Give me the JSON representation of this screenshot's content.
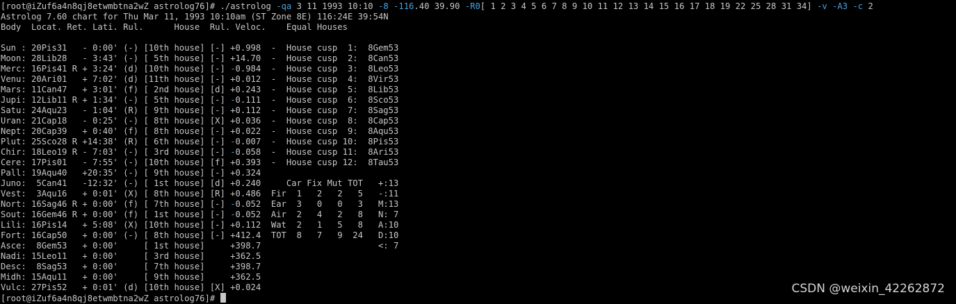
{
  "prompt": {
    "text": "[root@iZuf6a4n8qj8etwmbtna2wZ astrolog76]# ",
    "bottom": "[root@iZuf6a4n8qj8etwmbtna2wZ astrolog76]# "
  },
  "command": [
    {
      "t": "./astrolog ",
      "c": false
    },
    {
      "t": "-qa",
      "c": true
    },
    {
      "t": " 3 11 1993 10:10 ",
      "c": false
    },
    {
      "t": "-8",
      "c": true
    },
    {
      "t": " ",
      "c": false
    },
    {
      "t": "-116",
      "c": true
    },
    {
      "t": ".40 39.90 ",
      "c": false
    },
    {
      "t": "-R0",
      "c": true
    },
    {
      "t": "[ 1 2 3 4 5 6 7 8 9 10 11 12 13 14 15 16 17 18 19 22 25 28 31 34] ",
      "c": false
    },
    {
      "t": "-v",
      "c": true
    },
    {
      "t": " ",
      "c": false
    },
    {
      "t": "-A3",
      "c": true
    },
    {
      "t": " ",
      "c": false
    },
    {
      "t": "-c",
      "c": true
    },
    {
      "t": " 2",
      "c": false
    }
  ],
  "output": [
    [
      {
        "t": "Astrolog 7.60 chart for Thu Mar 11, 1993 10:10am (ST Zone 8E) 116:24E 39:54N"
      }
    ],
    [
      {
        "t": "Body  Locat. Ret. Lati. Rul.      House  Rul. Veloc.    Equal Houses"
      }
    ],
    [
      {
        "t": ""
      }
    ],
    [
      {
        "t": "Sun : 20Pis31   - 0:00' (-) [10th house] [-] +0.998  -  House cusp  1:  8Gem53"
      }
    ],
    [
      {
        "t": "Moon: 28Lib28   - 3:43' (-) [ 5th house] [-] +14.70  -  House cusp  2:  8Can53"
      }
    ],
    [
      {
        "t": "Merc: 16Pis41 R + 3:24' (d) [10th house] [-] "
      },
      {
        "t": "-",
        "c": true
      },
      {
        "t": "0.984  -  House cusp  3:  8Leo53"
      }
    ],
    [
      {
        "t": "Venu: 20Ari01   + 7:02' (d) [11th house] [-] +0.012  -  House cusp  4:  8Vir53"
      }
    ],
    [
      {
        "t": "Mars: 11Can47   + 3:01' (f) [ 2nd house] [d] +0.243  -  House cusp  5:  8Lib53"
      }
    ],
    [
      {
        "t": "Jupi: 12Lib11 R + 1:34' (-) [ 5th house] [-] "
      },
      {
        "t": "-",
        "c": true
      },
      {
        "t": "0.111  -  House cusp  6:  8Sco53"
      }
    ],
    [
      {
        "t": "Satu: 24Aqu23   - 1:04' (R) [ 9th house] [-] +0.112  -  House cusp  7:  8Sag53"
      }
    ],
    [
      {
        "t": "Uran: 21Cap18   - 0:25' (-) [ 8th house] [X] +0.036  -  House cusp  8:  8Cap53"
      }
    ],
    [
      {
        "t": "Nept: 20Cap39   + 0:40' (f) [ 8th house] [-] +0.022  -  House cusp  9:  8Aqu53"
      }
    ],
    [
      {
        "t": "Plut: 25Sco28 R +14:38' (R) [ 6th house] [-] "
      },
      {
        "t": "-",
        "c": true
      },
      {
        "t": "0.007  -  House cusp 10:  8Pis53"
      }
    ],
    [
      {
        "t": "Chir: 18Leo19 R - 7:03' (-) [ 3rd house] [-] "
      },
      {
        "t": "-",
        "c": true
      },
      {
        "t": "0.058  -  House cusp 11:  8Ari53"
      }
    ],
    [
      {
        "t": "Cere: 17Pis01   - 7:55' (-) [10th house] [f] +0.393  -  House cusp 12:  8Tau53"
      }
    ],
    [
      {
        "t": "Pall: 19Aqu40   +20:35' (-) [ 9th house] [-] +0.324"
      }
    ],
    [
      {
        "t": "Juno:  5Can41   -12:32' (-) [ 1st house] [d] +0.240     Car Fix Mut TOT   +:13"
      }
    ],
    [
      {
        "t": "Vest:  3Aqu16   + 0:01' (X) [ 8th house] [R] +0.486  Fir  1   2   2   5   -:11"
      }
    ],
    [
      {
        "t": "Nort: 16Sag46 R + 0:00' (f) [ 7th house] [-] "
      },
      {
        "t": "-",
        "c": true
      },
      {
        "t": "0.052  Ear  3   0   0   3   M:13"
      }
    ],
    [
      {
        "t": "Sout: 16Gem46 R + 0:00' (f) [ 1st house] [-] "
      },
      {
        "t": "-",
        "c": true
      },
      {
        "t": "0.052  Air  2   4   2   8   N: 7"
      }
    ],
    [
      {
        "t": "Lili: 16Pis14   + 5:08' (X) [10th house] [-] +0.112  Wat  2   1   5   8   A:10"
      }
    ],
    [
      {
        "t": "Fort: 16Cap50   + 0:00' (-) [ 8th house] [-] +412.4  TOT  8   7   9  24   D:10"
      }
    ],
    [
      {
        "t": "Asce:  8Gem53   + 0:00'     [ 1st house]     +398.7                       <: 7"
      }
    ],
    [
      {
        "t": "Nadi: 15Leo11   + 0:00'     [ 3rd house]     +362.5"
      }
    ],
    [
      {
        "t": "Desc:  8Sag53   + 0:00'     [ 7th house]     +398.7"
      }
    ],
    [
      {
        "t": "Midh: 15Aqu11   + 0:00'     [ 9th house]     +362.5"
      }
    ],
    [
      {
        "t": "Vulc: 27Pis52   + 0:01' (d) [10th house] [X] +0.024"
      }
    ]
  ],
  "watermark": "CSDN @weixin_42262872",
  "colors": {
    "background": "#000000",
    "text": "#c8c8c8",
    "argument": "#4aa3df"
  }
}
